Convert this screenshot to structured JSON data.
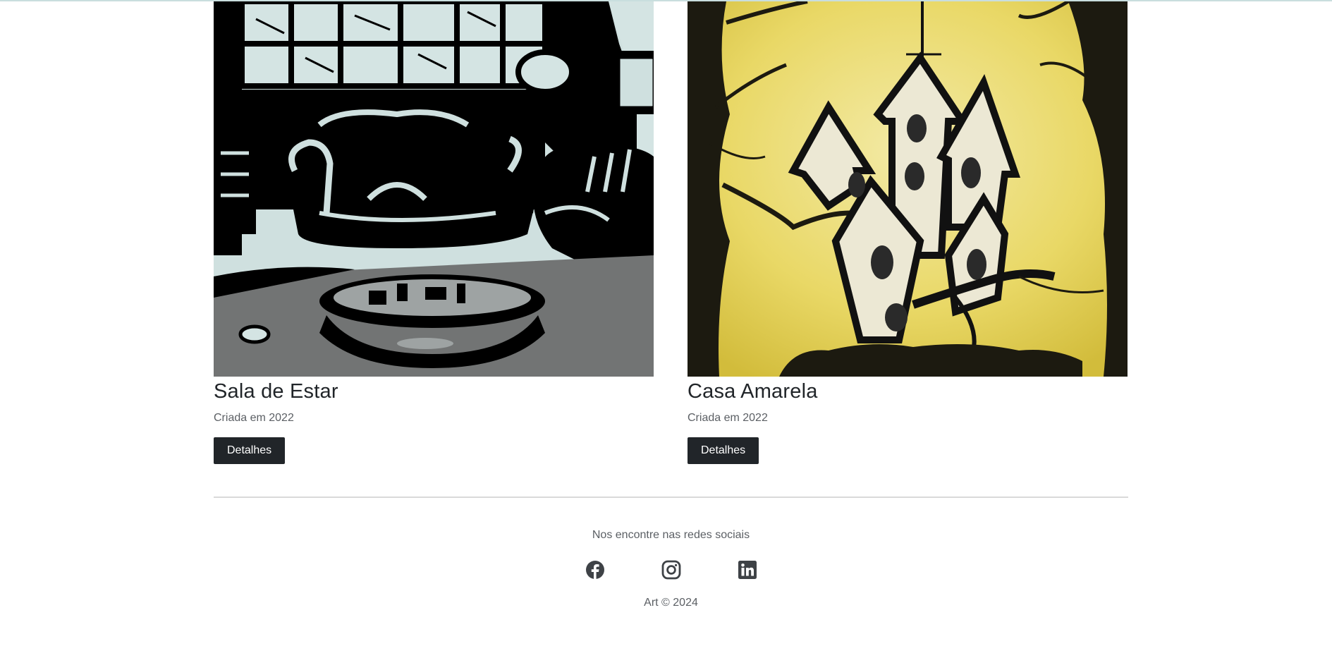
{
  "cards": [
    {
      "title": "Sala de Estar",
      "subtitle": "Criada em 2022",
      "button": "Detalhes",
      "image": "living-room-illustration"
    },
    {
      "title": "Casa Amarela",
      "subtitle": "Criada em 2022",
      "button": "Detalhes",
      "image": "yellow-house-illustration"
    }
  ],
  "footer": {
    "text": "Nos encontre nas redes sociais",
    "socials": [
      "facebook-icon",
      "instagram-icon",
      "linkedin-icon"
    ],
    "copyright": "Art © 2024"
  },
  "colors": {
    "button_bg": "#212529",
    "text_muted": "#5b5f64",
    "divider": "#d9d9d9",
    "yellow_bg": "#e6d66a"
  }
}
